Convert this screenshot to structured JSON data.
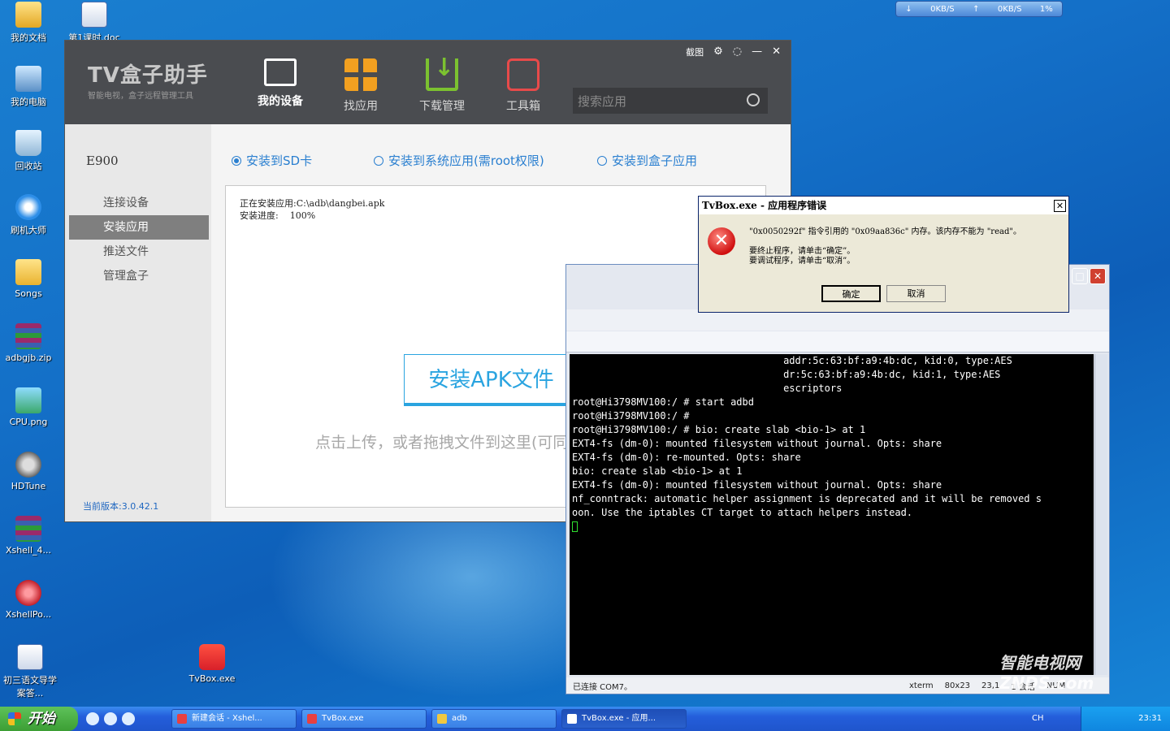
{
  "desktop": {
    "icons": [
      {
        "label": "我的文档",
        "icon": "my-documents-icon"
      },
      {
        "label": "第1课时.doc",
        "icon": "word-doc-icon"
      },
      {
        "label": "我的电脑",
        "icon": "my-computer-icon"
      },
      {
        "label": "回收站",
        "icon": "recycle-bin-icon"
      },
      {
        "label": "刷机大师",
        "icon": "flash-master-icon"
      },
      {
        "label": "Songs",
        "icon": "folder-icon"
      },
      {
        "label": "adbgjb.zip",
        "icon": "archive-icon"
      },
      {
        "label": "CPU.png",
        "icon": "png-image-icon"
      },
      {
        "label": "HDTune",
        "icon": "hdtune-icon"
      },
      {
        "label": "Xshell_4...",
        "icon": "archive-icon"
      },
      {
        "label": "XshellPo...",
        "icon": "xshell-icon"
      },
      {
        "label": "初三语文导学案答...",
        "icon": "word-doc-icon"
      },
      {
        "label": "TvBox.exe",
        "icon": "tvbox-icon"
      }
    ]
  },
  "speed_meter": {
    "down": "0KB/S",
    "up": "0KB/S",
    "cpu": "1%"
  },
  "tvbox": {
    "logo": "TV盒子助手",
    "slogan": "智能电视，盒子远程管理工具",
    "window_buttons": {
      "screenshot": "截图"
    },
    "nav": [
      {
        "label": "我的设备",
        "active": true
      },
      {
        "label": "找应用"
      },
      {
        "label": "下载管理"
      },
      {
        "label": "工具箱"
      }
    ],
    "search_placeholder": "搜索应用",
    "device_name": "E900",
    "sidebar": [
      "连接设备",
      "安装应用",
      "推送文件",
      "管理盒子"
    ],
    "version": "当前版本:3.0.42.1",
    "install_options": [
      "安装到SD卡",
      "安装到系统应用(需root权限)",
      "安装到盒子应用"
    ],
    "log_line1": "正在安装应用:C:\\adb\\dangbei.apk",
    "log_line2": "安装进度:    100%",
    "install_button": "安装APK文件",
    "hint": "点击上传，或者拖拽文件到这里(可同时拖拽多个)"
  },
  "error_dialog": {
    "title": "TvBox.exe - 应用程序错误",
    "message1": "\"0x0050292f\" 指令引用的 \"0x09aa836c\" 内存。该内存不能为 \"read\"。",
    "message2": "要终止程序，请单击“确定”。",
    "message3": "要调试程序，请单击“取消”。",
    "ok": "确定",
    "cancel": "取消"
  },
  "xshell": {
    "terminal_lines": [
      "                                    addr:5c:63:bf:a9:4b:dc, kid:0, type:AES",
      "                                    dr:5c:63:bf:a9:4b:dc, kid:1, type:AES",
      "",
      "",
      "                                    escriptors",
      "",
      "",
      "",
      "root@Hi3798MV100:/ # start adbd",
      "root@Hi3798MV100:/ #",
      "root@Hi3798MV100:/ # bio: create slab <bio-1> at 1",
      "EXT4-fs (dm-0): mounted filesystem without journal. Opts: share",
      "EXT4-fs (dm-0): re-mounted. Opts: share",
      "bio: create slab <bio-1> at 1",
      "EXT4-fs (dm-0): mounted filesystem without journal. Opts: share",
      "nf_conntrack: automatic helper assignment is deprecated and it will be removed s",
      "oon. Use the iptables CT target to attach helpers instead."
    ],
    "status_connected": "已连接 COM7。",
    "status_term": "xterm",
    "status_size": "80x23",
    "status_pos": "23,1",
    "status_sessions": "1 会话",
    "status_num": "NUM"
  },
  "taskbar": {
    "start": "开始",
    "buttons": [
      {
        "label": "新建会话 - Xshel..."
      },
      {
        "label": "TvBox.exe"
      },
      {
        "label": "adb"
      },
      {
        "label": "TvBox.exe - 应用..."
      }
    ],
    "lang": "CH",
    "clock": "23:31"
  },
  "watermark": "智能电视网 ZNDS.com"
}
